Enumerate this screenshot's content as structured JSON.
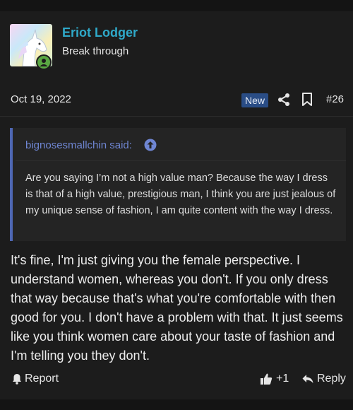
{
  "post": {
    "username": "Eriot Lodger",
    "user_title": "Break through",
    "date": "Oct 19, 2022",
    "badge": "New",
    "post_number": "#26",
    "quote": {
      "author_line": "bignosesmallchin said:",
      "text": "Are you saying I’m not a high value man? Because the way I dress is that of a high value, prestigious man, I think you are just jealous of my unique sense of fashion, I am quite content with the way I dress."
    },
    "message": "It's fine, I'm just giving you the female perspective. I understand women, whereas you don't. If you only dress that way because that's what you're comfortable with then good for you. I don't have a problem with that. It just seems like you think women care about your taste of fashion and I'm telling you they don't.",
    "actions": {
      "report": "Report",
      "like_count": "+1",
      "reply": "Reply"
    }
  },
  "colors": {
    "background": "#1c1c1c",
    "username": "#2fa9c9",
    "quote_accent": "#4e67b3",
    "badge": "#2a4d86",
    "online": "#5aa843"
  }
}
